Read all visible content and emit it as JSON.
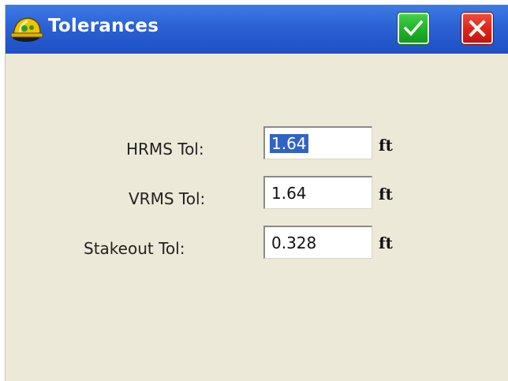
{
  "window": {
    "title": "Tolerances",
    "ok_icon": "checkmark-icon",
    "close_icon": "close-icon",
    "app_icon": "hard-hat-icon"
  },
  "fields": [
    {
      "label": "HRMS Tol:",
      "value": "1.64",
      "unit": "ft",
      "selected": true
    },
    {
      "label": "VRMS Tol:",
      "value": "1.64",
      "unit": "ft",
      "selected": false
    },
    {
      "label": "Stakeout Tol:",
      "value": "0.328",
      "unit": "ft",
      "selected": false
    }
  ],
  "colors": {
    "titlebar": "#2b61d4",
    "background": "#ece9d8",
    "ok_button": "#1fb227",
    "close_button": "#dc2418",
    "selection": "#3163c5"
  }
}
